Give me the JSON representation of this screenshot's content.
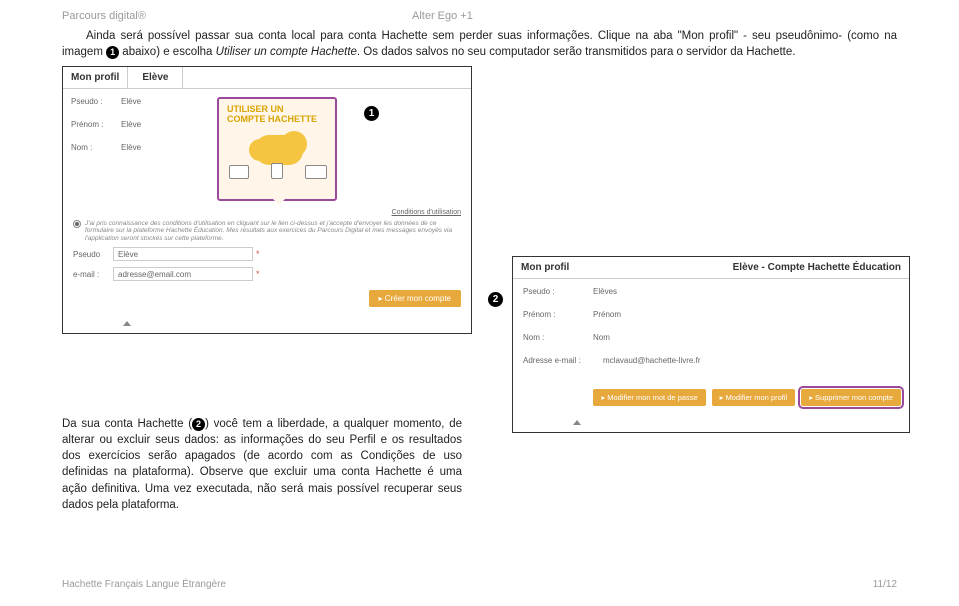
{
  "header": {
    "left": "Parcours digital®",
    "right": "Alter Ego +1"
  },
  "para1_pre": "Ainda será possível passar sua conta local para conta Hachette sem perder suas informações. Clique na aba \"Mon profil\" - seu pseudônimo- (como na imagem ",
  "para1_mid": " abaixo) e escolha ",
  "para1_italic": "Utiliser un compte Hachette",
  "para1_post": ". Os dados salvos no seu computador serão transmitidos para o servidor da Hachette.",
  "shot1": {
    "tab_profil": "Mon profil",
    "tab_eleve": "Elève",
    "pseudo_lbl": "Pseudo :",
    "pseudo_val": "Elève",
    "prenom_lbl": "Prénom :",
    "prenom_val": "Elève",
    "nom_lbl": "Nom :",
    "nom_val": "Elève",
    "utiliser_l1": "Utiliser un",
    "utiliser_l2": "compte Hachette",
    "cond": "Conditions d'utilisation",
    "terms": "J'ai pris connaissance des conditions d'utilisation en cliquant sur le lien ci-dessus et j'accepte d'envoyer les données de ce formulaire sur la plateforme Hachette Éducation. Mes résultats aux exercices du Parcours Digital et mes messages envoyés via l'application seront stockés sur cette plateforme.",
    "pseudo2_lbl": "Pseudo",
    "pseudo2_val": "Elève",
    "email_lbl": "e-mail :",
    "email_val": "adresse@email.com",
    "creer_btn": "▸ Créer mon compte"
  },
  "shot2": {
    "title": "Mon profil",
    "right": "Elève  - Compte Hachette Éducation",
    "pseudo_lbl": "Pseudo :",
    "pseudo_val": "Elèves",
    "prenom_lbl": "Prénom :",
    "prenom_val": "Prénom",
    "nom_lbl": "Nom :",
    "nom_val": "Nom",
    "adresse_lbl": "Adresse e-mail :",
    "adresse_val": "mclavaud@hachette-livre.fr",
    "btn1": "▸ Modifier mon mot de passe",
    "btn2": "▸ Modifier mon profil",
    "btn3": "▸ Supprimer mon compte"
  },
  "para2_pre": "Da sua conta Hachette (",
  "para2_post": ") você tem a liberdade, a qualquer momento, de alterar ou excluir seus dados: as informações do seu Perfil e os resultados dos exercícios serão apagados (de acordo com as ",
  "para2_italic": "Condições de uso",
  "para2_end": " definidas na plataforma). Observe que excluir uma conta Hachette é uma ação definitiva. Uma vez executada, não será mais possível recuperar seus dados pela plataforma.",
  "footer": {
    "left": "Hachette Français Langue Étrangère",
    "right": "11/12"
  },
  "badges": {
    "one": "1",
    "two": "2"
  }
}
